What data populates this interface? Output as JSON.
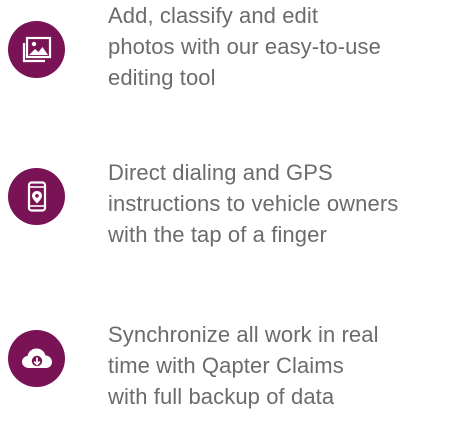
{
  "features": [
    {
      "icon": "photo-gallery-icon",
      "lines": [
        "Add, classify and edit",
        "photos with our easy-to-use",
        "editing tool"
      ]
    },
    {
      "icon": "phone-location-icon",
      "lines": [
        "Direct dialing and GPS",
        "instructions to vehicle owners",
        "with the tap of a finger"
      ]
    },
    {
      "icon": "cloud-download-icon",
      "lines": [
        "Synchronize all work in real",
        "time with Qapter Claims",
        "with full backup of data"
      ]
    }
  ],
  "colors": {
    "accent": "#7a1256",
    "text": "#6b6b6b"
  }
}
